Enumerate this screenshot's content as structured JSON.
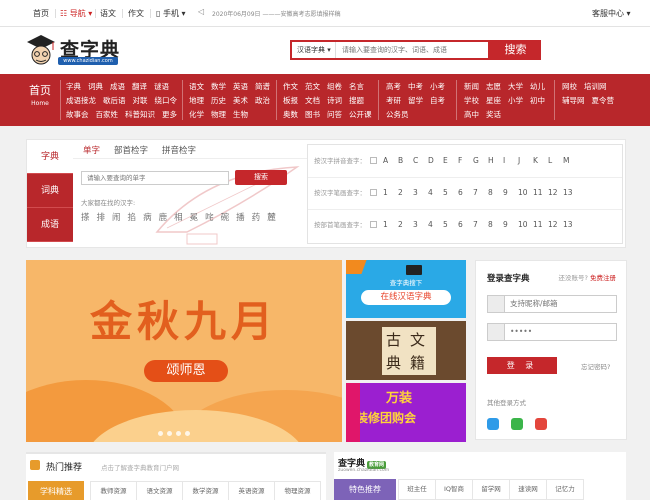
{
  "topbar": {
    "home": "首页",
    "nav": "导航",
    "chinese": "语文",
    "essay": "作文",
    "mobile": "手机",
    "notice": "2020年06月09日 ———安徽高考志愿填报样稿",
    "service": "客服中心"
  },
  "header": {
    "logo_text": "查字典",
    "logo_url": "www.chazidian.com",
    "search_select": "汉语字典",
    "search_placeholder": "请输入要查询的汉字、词语、成语",
    "search_button": "搜索"
  },
  "nav": {
    "home_zh": "首页",
    "home_en": "Home",
    "groups": [
      {
        "rows": [
          [
            "字典",
            "词典",
            "成语",
            "翻译",
            "谜语"
          ],
          [
            "成语接龙",
            "歇后语",
            "对联",
            "绕口令"
          ],
          [
            "故事会",
            "百家姓",
            "科普知识",
            "更多"
          ]
        ]
      },
      {
        "rows": [
          [
            "语文",
            "数学",
            "英语",
            "简谱"
          ],
          [
            "地理",
            "历史",
            "美术",
            "政治"
          ],
          [
            "化学",
            "物理",
            "生物"
          ]
        ]
      },
      {
        "rows": [
          [
            "作文",
            "范文",
            "组卷",
            "名言"
          ],
          [
            "板报",
            "文档",
            "诗词",
            "搜题"
          ],
          [
            "奥数",
            "图书",
            "问答",
            "公开课"
          ]
        ]
      },
      {
        "rows": [
          [
            "高考",
            "中考",
            "小考"
          ],
          [
            "考研",
            "留学",
            "自考"
          ],
          [
            "公务员"
          ]
        ]
      },
      {
        "rows": [
          [
            "新闻",
            "志愿",
            "大学",
            "幼儿"
          ],
          [
            "学校",
            "星座",
            "小学",
            "初中"
          ],
          [
            "高中",
            "奖话"
          ]
        ]
      },
      {
        "rows": [
          [
            "网校",
            "培训网"
          ],
          [
            "辅导网",
            "夏令营"
          ]
        ]
      }
    ]
  },
  "lookup": {
    "side_tabs": [
      "字典",
      "词典",
      "成语"
    ],
    "tabs": [
      "单字",
      "部首检字",
      "拼音检字"
    ],
    "input_placeholder": "请输入要查询的单字",
    "button": "搜索",
    "history_title": "大家都在找的汉字:",
    "history": [
      "搽",
      "排",
      "闹",
      "掐",
      "病",
      "鹿",
      "相",
      "冕",
      "咤",
      "碗",
      "播",
      "药",
      "麓"
    ],
    "index_rows": [
      {
        "label": "按汉字拼音查字：",
        "keys": [
          "A",
          "B",
          "C",
          "D",
          "E",
          "F",
          "G",
          "H",
          "I",
          "J",
          "K",
          "L",
          "M"
        ]
      },
      {
        "label": "按汉字笔画查字：",
        "keys": [
          "1",
          "2",
          "3",
          "4",
          "5",
          "6",
          "7",
          "8",
          "9",
          "10",
          "11",
          "12",
          "13"
        ]
      },
      {
        "label": "按部首笔画查字：",
        "keys": [
          "1",
          "2",
          "3",
          "4",
          "5",
          "6",
          "7",
          "8",
          "9",
          "10",
          "11",
          "12",
          "13"
        ]
      }
    ]
  },
  "banner": {
    "title": "金秋九月",
    "subtitle": "颂师恩"
  },
  "ads": {
    "ad1_top": "查字典搜下",
    "ad1_main": "在线汉语字典",
    "ad2_text": [
      "古",
      "文",
      "典",
      "籍"
    ],
    "ad3_line1": "万装",
    "ad3_line2": "装修团购会"
  },
  "login": {
    "title": "登录查字典",
    "no_account": "还没账号?",
    "register": "免费注册",
    "username_placeholder": "支持昵称/邮箱",
    "password_value": "•••••",
    "button": "登 录",
    "forgot": "忘记密码?",
    "other": "其他登录方式"
  },
  "hot": {
    "title": "热门推荐",
    "subtitle": "点击了解查字典教育门户网",
    "tab": "学科精选",
    "links": [
      "教师资源",
      "语文资源",
      "数学资源",
      "英语资源",
      "物理资源"
    ]
  },
  "feat": {
    "logo": "查字典",
    "badge": "教育网",
    "url": "zuowen.chazidian.com",
    "tab": "特色推荐",
    "links": [
      "班主任",
      "IQ智商",
      "留学网",
      "速读网",
      "记忆力"
    ]
  },
  "colors": {
    "brand_red": "#b8272b",
    "orange": "#e79b2b",
    "purple": "#7d63b8"
  }
}
